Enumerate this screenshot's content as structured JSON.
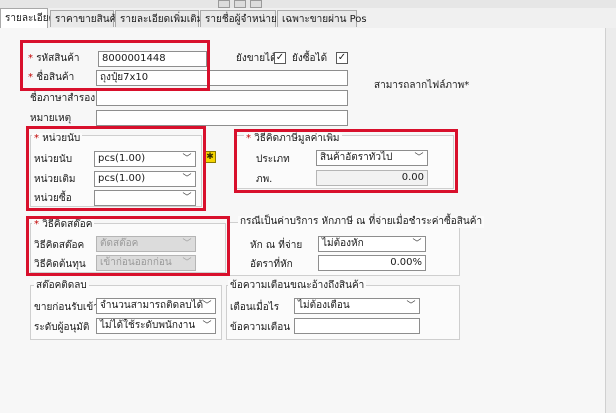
{
  "tabs": [
    {
      "label": "รายละเอียด",
      "active": true
    },
    {
      "label": "ราคาขายสินค้า"
    },
    {
      "label": "รายละเอียดเพิ่มเติม"
    },
    {
      "label": "รายชื่อผู้จำหน่าย"
    },
    {
      "label": "เฉพาะขายผ่าน Pos"
    }
  ],
  "product": {
    "code_label": "รหัสสินค้า",
    "code_value": "8000001448",
    "name_label": "ชื่อสินค้า",
    "name_value": "ถุงปุ๋ย7x10",
    "sell_label": "ยังขายได้",
    "buy_label": "ยังซื้อได้",
    "sell_checked": "✓",
    "buy_checked": "✓",
    "alt_name_label": "ชื่อภาษาสำรอง",
    "alt_name_value": "",
    "note_label": "หมายเหตุ",
    "note_value": "",
    "image_hint": "สามารถลากไฟล์ภาพ"
  },
  "units": {
    "title": "หน่วยนับ",
    "count_label": "หน่วยนับ",
    "count_value": "pcs(1.00)",
    "stock_label": "หน่วยเติม",
    "stock_value": "pcs(1.00)",
    "buy_label": "หน่วยซื้อ",
    "buy_value": ""
  },
  "vat": {
    "title": "วิธีคิดภาษีมูลค่าเพิ่ม",
    "type_label": "ประเภท",
    "type_value": "สินค้าอัตราทั่วไป",
    "rate_label": "ภพ.",
    "rate_value": "0.00"
  },
  "stock_calc": {
    "title": "วิธีคิดสต๊อค",
    "method_label": "วิธีคิดสต๊อค",
    "method_value": "ตัดสต๊อค",
    "cost_label": "วิธีคิดต้นทุน",
    "cost_value": "เข้าก่อนออกก่อน"
  },
  "service": {
    "title": "กรณีเป็นค่าบริการ หักภาษี ณ ที่จ่ายเมื่อชำระค่าซื้อสินค้า",
    "withhold_label": "หัก ณ ที่จ่าย",
    "withhold_value": "ไม่ต้องหัก",
    "rate_label": "อัตราที่หัก",
    "rate_value": "0.00%"
  },
  "negative_stock": {
    "title": "สต๊อคติดลบ",
    "sell_label": "ขายก่อนรับเข้า",
    "sell_value": "จำนวนสามารถติดลบได้",
    "level_label": "ระดับผู้อนุมัติ",
    "level_value": "ไม่ได้ใช้ระดับพนักงาน"
  },
  "warning": {
    "title": "ข้อความเตือนขณะอ้างถึงสินค้า",
    "when_label": "เตือนเมื่อไร",
    "when_value": "ไม่ต้องเตือน",
    "msg_label": "ข้อความเตือน",
    "msg_value": ""
  },
  "colors": {
    "highlight_border": "#d8102c",
    "badge": "#f5d400"
  }
}
